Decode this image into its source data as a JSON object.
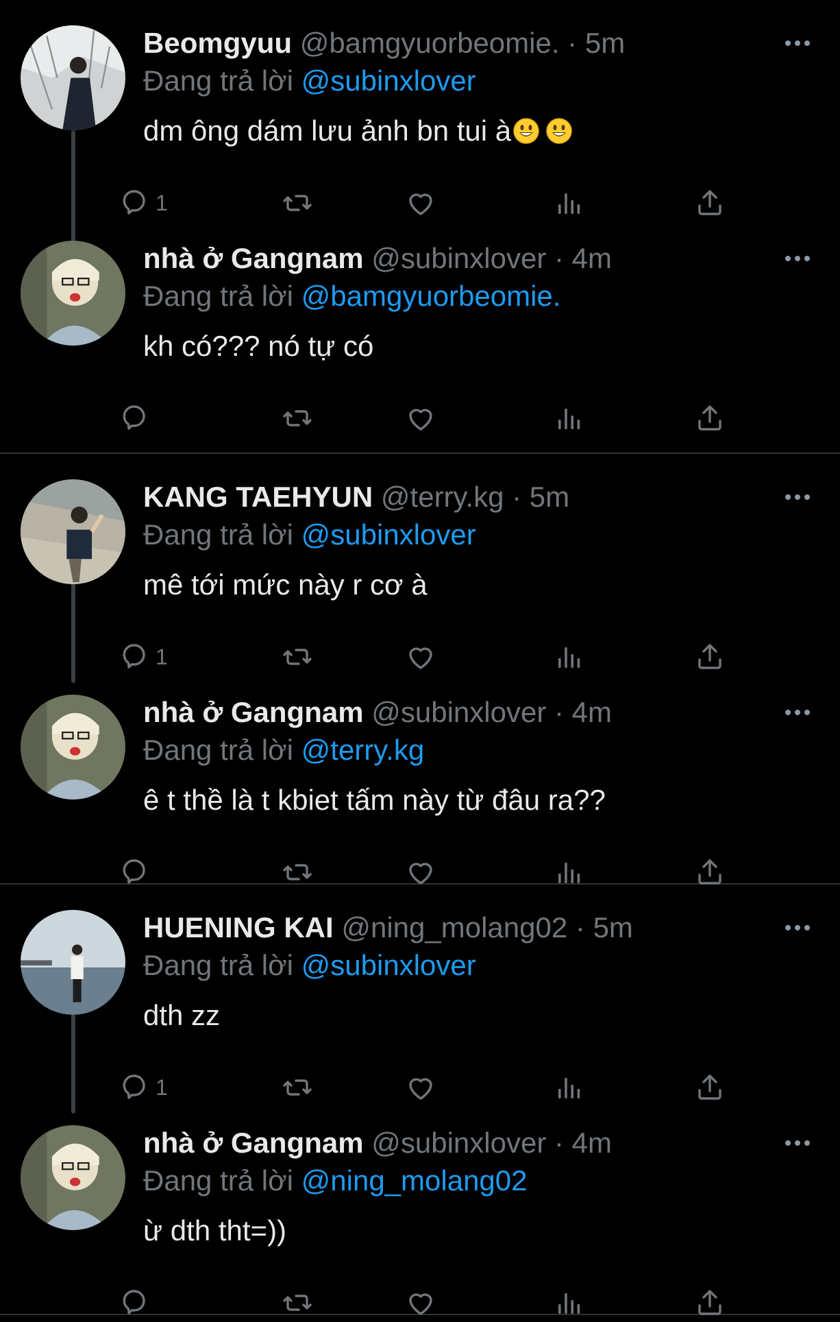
{
  "colors": {
    "background": "#000000",
    "name": "#e7e9ea",
    "muted": "#71767b",
    "mention": "#1d9bf0",
    "thread_line": "#3a3f44",
    "divider": "#2f3336"
  },
  "tweets": [
    {
      "name": "Beomgyuu",
      "handle": "@bamgyuorbeomie.",
      "sep": " · ",
      "time": "5m",
      "replying_prefix": "Đang trả lời ",
      "replying_to": "@subinxlover",
      "text": "dm ông dám lưu ảnh bn tui à",
      "emoji": "smiley-emoji",
      "reply_count": "1",
      "avatar": "avatar-photo"
    },
    {
      "name": "nhà ở Gangnam",
      "handle": "@subinxlover",
      "sep": " · ",
      "time": "4m",
      "replying_prefix": "Đang trả lời ",
      "replying_to": "@bamgyuorbeomie.",
      "text": "kh có??? nó tự có",
      "reply_count": "",
      "avatar": "avatar-photo"
    },
    {
      "name": "KANG TAEHYUN",
      "handle": "@terry.kg",
      "sep": " · ",
      "time": "5m",
      "replying_prefix": "Đang trả lời ",
      "replying_to": "@subinxlover",
      "text": "mê tới mức này r cơ à",
      "reply_count": "1",
      "avatar": "avatar-photo"
    },
    {
      "name": "nhà ở Gangnam",
      "handle": "@subinxlover",
      "sep": " · ",
      "time": "4m",
      "replying_prefix": "Đang trả lời ",
      "replying_to": "@terry.kg",
      "text": "ê t thề là t kbiet tấm này từ đâu ra??",
      "reply_count": "",
      "avatar": "avatar-photo"
    },
    {
      "name": "HUENING KAI",
      "handle": "@ning_molang02",
      "sep": " · ",
      "time": "5m",
      "replying_prefix": "Đang trả lời ",
      "replying_to": "@subinxlover",
      "text": "dth zz",
      "reply_count": "1",
      "avatar": "avatar-photo"
    },
    {
      "name": "nhà ở Gangnam",
      "handle": "@subinxlover",
      "sep": " · ",
      "time": "4m",
      "replying_prefix": "Đang trả lời ",
      "replying_to": "@ning_molang02",
      "text": "ừ dth tht=))",
      "reply_count": "",
      "avatar": "avatar-photo"
    }
  ],
  "icons": {
    "more": "more-icon",
    "reply": "reply-icon",
    "retweet": "retweet-icon",
    "like": "like-icon",
    "views": "views-icon",
    "share": "share-icon"
  }
}
